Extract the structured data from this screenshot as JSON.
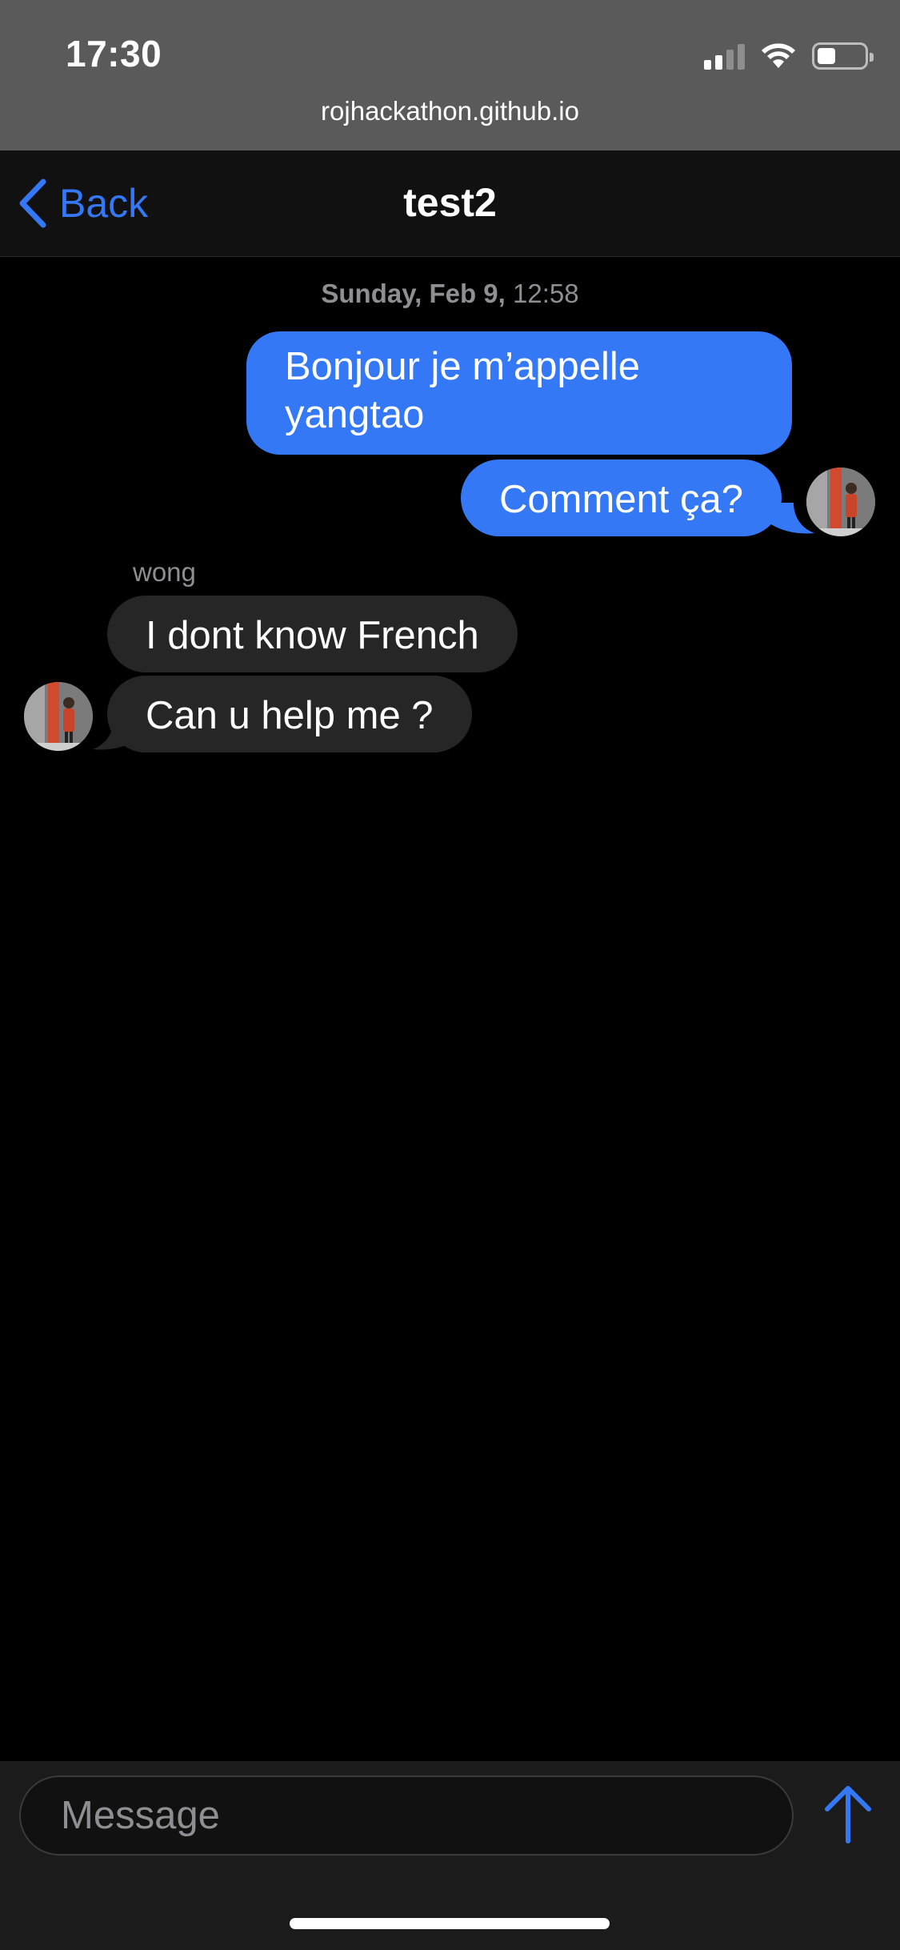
{
  "status_bar": {
    "time": "17:30"
  },
  "browser": {
    "url": "rojhackathon.github.io"
  },
  "nav": {
    "back_label": "Back",
    "title": "test2"
  },
  "conversation": {
    "date_day": "Sunday, Feb 9,",
    "date_time": "12:58",
    "outgoing": [
      "Bonjour je m’appelle yangtao",
      "Comment ça?"
    ],
    "incoming_sender": "wong",
    "incoming": [
      "I dont know French",
      "Can u help me ?"
    ]
  },
  "composer": {
    "placeholder": "Message"
  },
  "colors": {
    "accent": "#3478f6",
    "incoming_bubble": "#262626"
  },
  "icons": [
    "signal-icon",
    "wifi-icon",
    "battery-icon",
    "chevron-left-icon",
    "send-arrow-icon"
  ]
}
